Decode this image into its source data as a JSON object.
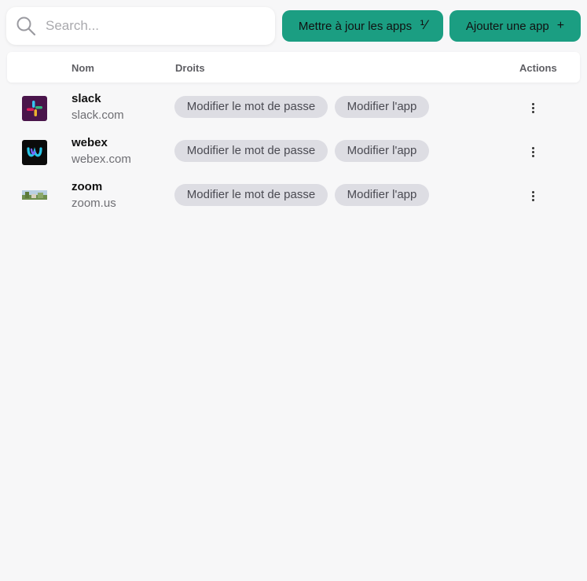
{
  "search": {
    "placeholder": "Search..."
  },
  "toolbar": {
    "update_label": "Mettre à jour les apps",
    "update_icon": "percent-icon",
    "add_label": "Ajouter une app",
    "add_icon": "plus-icon"
  },
  "table": {
    "headers": {
      "name": "Nom",
      "rights": "Droits",
      "actions": "Actions"
    },
    "rows": [
      {
        "name": "slack",
        "domain": "slack.com",
        "rights": [
          "Modifier le mot de passe",
          "Modifier l'app"
        ],
        "logo": "slack-logo-icon"
      },
      {
        "name": "webex",
        "domain": "webex.com",
        "rights": [
          "Modifier le mot de passe",
          "Modifier l'app"
        ],
        "logo": "webex-logo-icon"
      },
      {
        "name": "zoom",
        "domain": "zoom.us",
        "rights": [
          "Modifier le mot de passe",
          "Modifier l'app"
        ],
        "logo": "zoom-logo-icon"
      }
    ]
  },
  "colors": {
    "accent": "#1b9e82",
    "chip": "#dddde3",
    "background": "#f7f7f8"
  }
}
